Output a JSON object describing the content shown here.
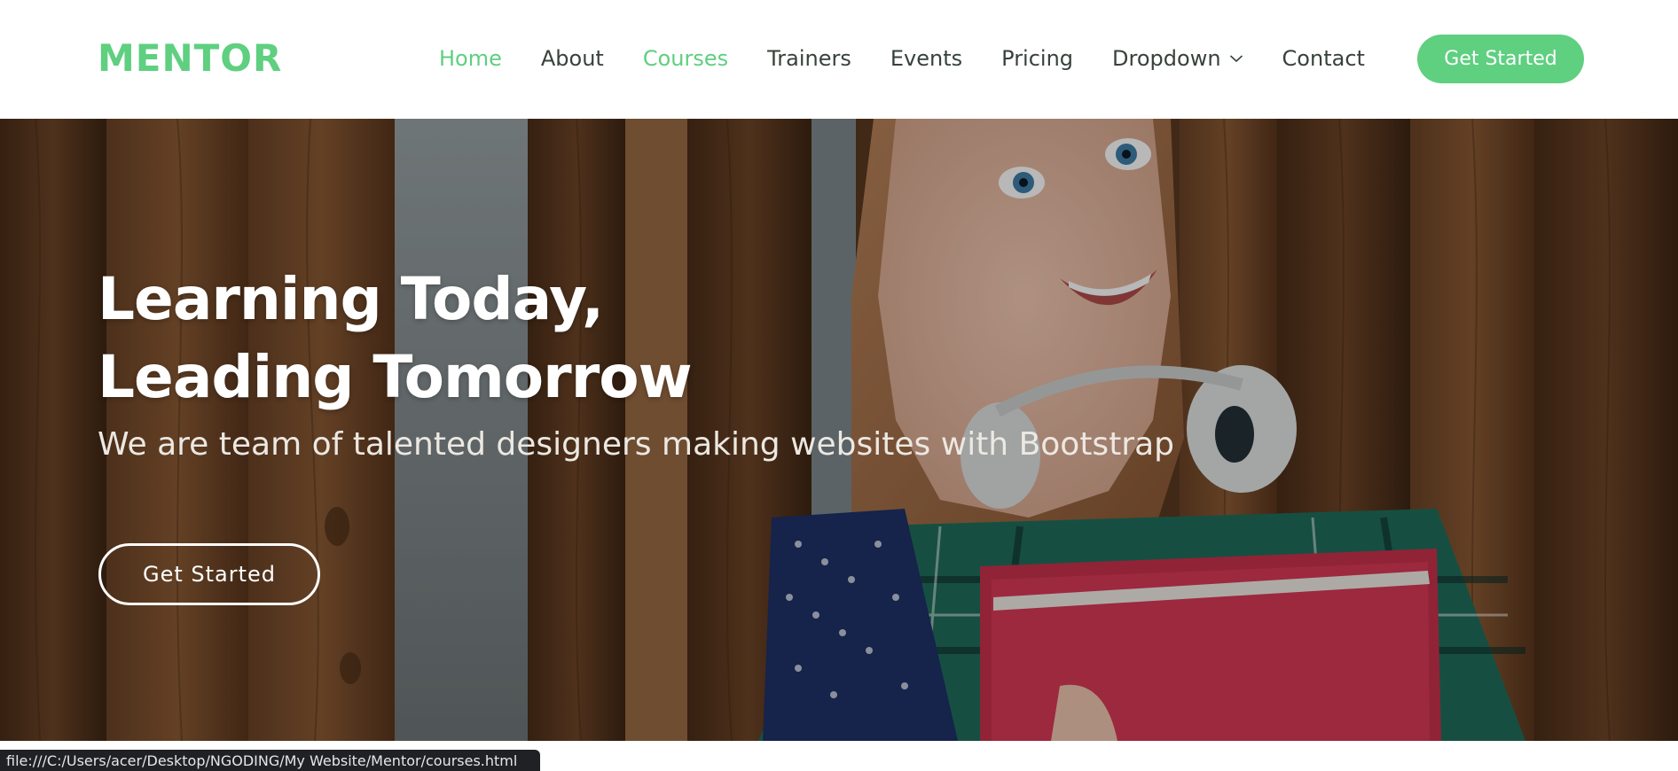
{
  "brand": {
    "logo": "MENTOR",
    "accent": "#5fcf80"
  },
  "nav": {
    "items": [
      {
        "label": "Home",
        "active": true
      },
      {
        "label": "About",
        "active": false
      },
      {
        "label": "Courses",
        "active": true
      },
      {
        "label": "Trainers",
        "active": false
      },
      {
        "label": "Events",
        "active": false
      },
      {
        "label": "Pricing",
        "active": false
      },
      {
        "label": "Dropdown",
        "active": false,
        "icon": "chevron-down-icon"
      },
      {
        "label": "Contact",
        "active": false
      }
    ],
    "cta_label": "Get Started"
  },
  "hero": {
    "title_line1": "Learning Today,",
    "title_line2": "Leading Tomorrow",
    "subtitle": "We are team of talented designers making websites with Bootstrap",
    "button_label": "Get Started"
  },
  "status_bar": {
    "url": "file:///C:/Users/acer/Desktop/NGODING/My Website/Mentor/courses.html"
  }
}
